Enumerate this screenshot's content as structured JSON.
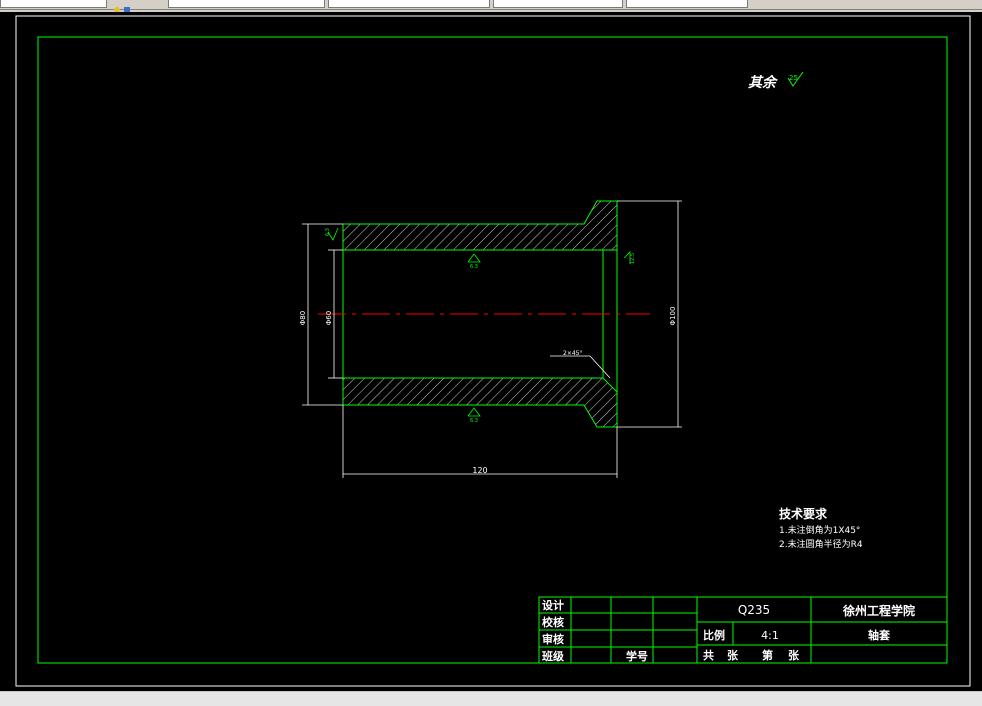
{
  "drawing": {
    "surface_roughness": {
      "label": "其余",
      "value": "25"
    },
    "hatch_roughness_left": "6.3",
    "inner_roughness_top": "6.3",
    "inner_roughness_bottom": "6.3",
    "flange_roughness": "12.5",
    "dimensions": {
      "length": "120",
      "outer_diameter": "Φ100",
      "bore_diameter": "Φ60",
      "shaft_diameter": "Φ80",
      "chamfer": "2×45°"
    },
    "tech_req": {
      "title": "技术要求",
      "lines": [
        "1.未注倒角为1X45°",
        "2.未注圆角半径为R4"
      ]
    },
    "title_block": {
      "design": "设计",
      "check": "校核",
      "review": "审核",
      "class": "班级",
      "student_id": "学号",
      "material": "Q235",
      "school": "徐州工程学院",
      "scale_label": "比例",
      "scale_value": "4:1",
      "part_name": "轴套",
      "sheet_total_label": "共",
      "sheet_unit1": "张",
      "sheet_no_label": "第",
      "sheet_unit2": "张"
    }
  }
}
